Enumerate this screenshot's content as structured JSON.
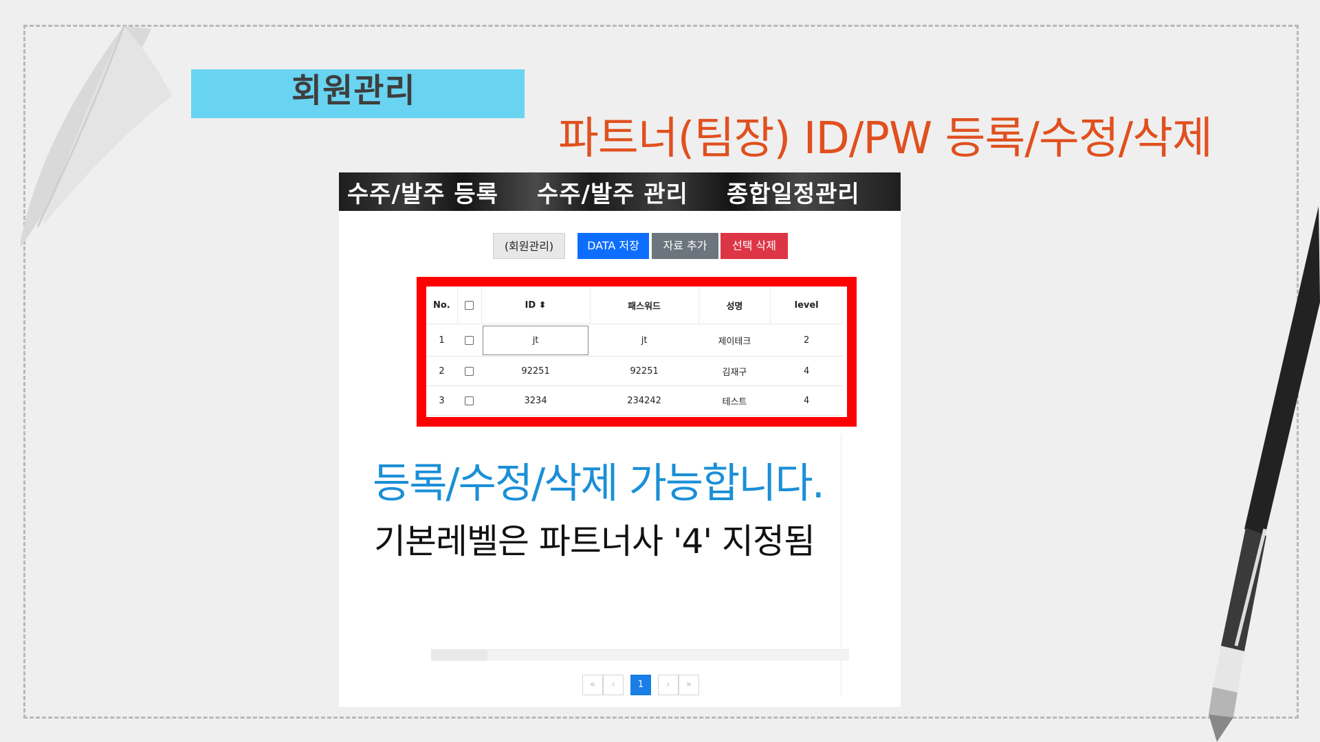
{
  "slide": {
    "section_tag": "회원관리",
    "headline": "파트너(팀장) ID/PW 등록/수정/삭제"
  },
  "navbar": {
    "items": [
      "수주/발주 등록",
      "수주/발주 관리",
      "종합일정관리"
    ]
  },
  "toolbar": {
    "member_label": "(회원관리)",
    "save_label": "DATA 저장",
    "add_label": "자료 추가",
    "delete_label": "선택 삭제"
  },
  "table": {
    "headers": [
      "No.",
      "",
      "ID ⬍",
      "패스워드",
      "성명",
      "level"
    ],
    "rows": [
      {
        "no": "1",
        "id": "jt",
        "password": "jt",
        "name": "제이테크",
        "level": "2"
      },
      {
        "no": "2",
        "id": "92251",
        "password": "92251",
        "name": "김재구",
        "level": "4"
      },
      {
        "no": "3",
        "id": "3234",
        "password": "234242",
        "name": "테스트",
        "level": "4"
      }
    ]
  },
  "pagination": {
    "first": "«",
    "prev": "‹",
    "current": "1",
    "next": "›",
    "last": "»"
  },
  "captions": {
    "main": "등록/수정/삭제 가능합니다.",
    "sub": "기본레벨은 파트너사 '4' 지정됨"
  },
  "colors": {
    "accent_orange": "#e0501f",
    "caption_blue": "#1b8fd7",
    "tag_cyan": "#69d4f1",
    "highlight_red": "#ff0000",
    "primary_button": "#0d6efd",
    "secondary_button": "#6c757d",
    "danger_button": "#dc3545"
  }
}
